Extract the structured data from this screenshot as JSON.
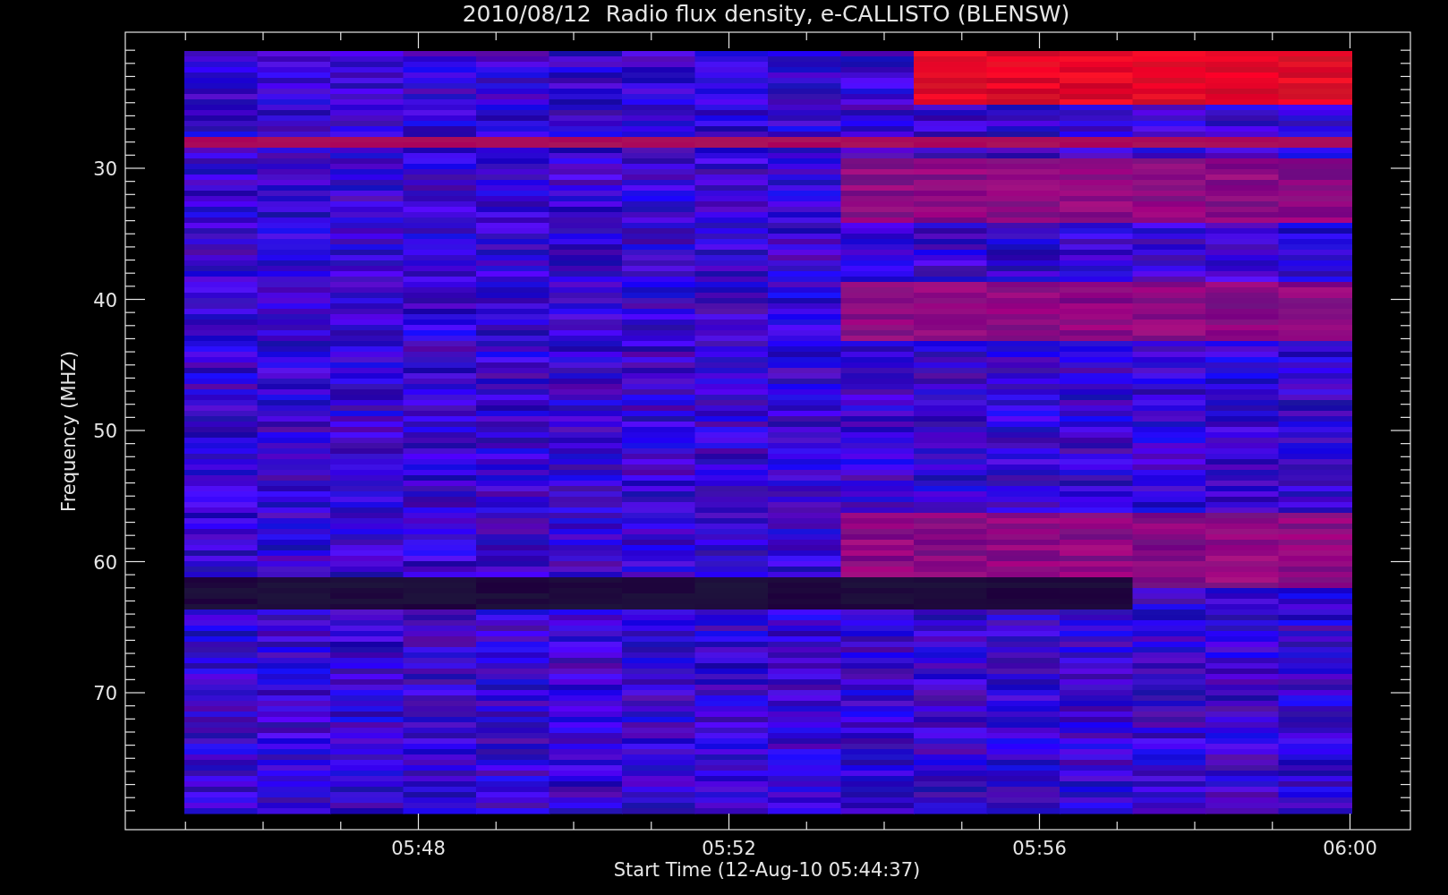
{
  "plot": {
    "title": "2010/08/12  Radio flux density, e-CALLISTO (BLENSW)",
    "xlabel": "Start Time (12-Aug-10 05:44:37)",
    "ylabel": "Frequency (MHZ)",
    "xticks": [
      "05:48",
      "05:52",
      "05:56",
      "06:00"
    ],
    "yticks": [
      "30",
      "40",
      "50",
      "60",
      "70"
    ]
  }
}
